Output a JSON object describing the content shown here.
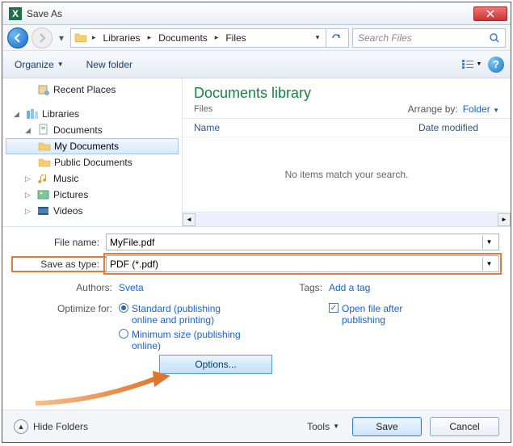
{
  "title": "Save As",
  "breadcrumbs": [
    "Libraries",
    "Documents",
    "Files"
  ],
  "search": {
    "placeholder": "Search Files"
  },
  "toolbar": {
    "organize": "Organize",
    "newfolder": "New folder"
  },
  "sidebar": {
    "recent": "Recent Places",
    "libraries": "Libraries",
    "documents": "Documents",
    "mydocs": "My Documents",
    "pubdocs": "Public Documents",
    "music": "Music",
    "pictures": "Pictures",
    "videos": "Videos"
  },
  "content": {
    "header_title": "Documents library",
    "header_sub": "Files",
    "arrange_label": "Arrange by:",
    "arrange_value": "Folder",
    "col_name": "Name",
    "col_date": "Date modified",
    "empty": "No items match your search."
  },
  "form": {
    "filename_label": "File name:",
    "filename_value": "MyFile.pdf",
    "savetype_label": "Save as type:",
    "savetype_value": "PDF (*.pdf)",
    "authors_label": "Authors:",
    "authors_value": "Sveta",
    "tags_label": "Tags:",
    "tags_value": "Add a tag",
    "optimize_label": "Optimize for:",
    "opt_standard": "Standard (publishing online and printing)",
    "opt_minimum": "Minimum size (publishing online)",
    "openafter": "Open file after publishing",
    "options_btn": "Options..."
  },
  "footer": {
    "hide": "Hide Folders",
    "tools": "Tools",
    "save": "Save",
    "cancel": "Cancel"
  }
}
